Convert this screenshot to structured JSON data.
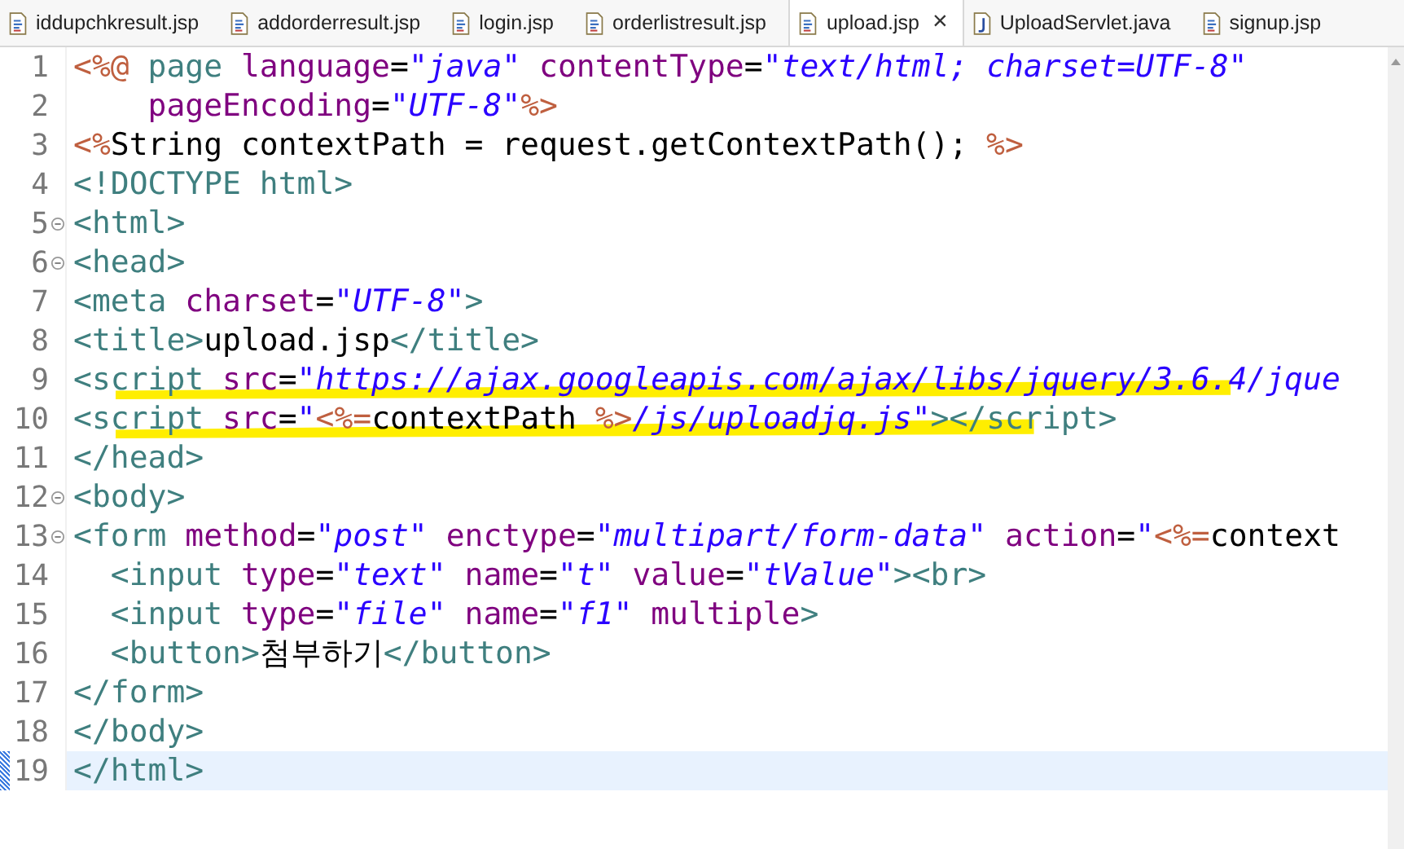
{
  "tabs": [
    {
      "label": "iddupchkresult.jsp",
      "kind": "jsp",
      "selected": false
    },
    {
      "label": "addorderresult.jsp",
      "kind": "jsp",
      "selected": false
    },
    {
      "label": "login.jsp",
      "kind": "jsp",
      "selected": false
    },
    {
      "label": "orderlistresult.jsp",
      "kind": "jsp",
      "selected": false
    },
    {
      "label": "upload.jsp",
      "kind": "jsp",
      "selected": true,
      "close": "×"
    },
    {
      "label": "UploadServlet.java",
      "kind": "java",
      "selected": false
    },
    {
      "label": "signup.jsp",
      "kind": "jsp",
      "selected": false
    }
  ],
  "editor": {
    "lines": [
      {
        "number": "1",
        "foldable": false,
        "current": false,
        "marked": false,
        "tokens": [
          {
            "kind": "jsp",
            "text": "<%@"
          },
          {
            "kind": "tag",
            "text": " page"
          },
          {
            "kind": "attr",
            "text": " language"
          },
          {
            "kind": "text",
            "text": "="
          },
          {
            "kind": "value",
            "text": "\"java\""
          },
          {
            "kind": "attr",
            "text": " contentType"
          },
          {
            "kind": "text",
            "text": "="
          },
          {
            "kind": "value",
            "text": "\"text/html; charset=UTF-8\""
          }
        ]
      },
      {
        "number": "2",
        "foldable": false,
        "current": false,
        "marked": false,
        "tokens": [
          {
            "kind": "attr",
            "text": "    pageEncoding"
          },
          {
            "kind": "text",
            "text": "="
          },
          {
            "kind": "value",
            "text": "\"UTF-8\""
          },
          {
            "kind": "jsp",
            "text": "%>"
          }
        ]
      },
      {
        "number": "3",
        "foldable": false,
        "current": false,
        "marked": false,
        "tokens": [
          {
            "kind": "jsp",
            "text": "<%"
          },
          {
            "kind": "text",
            "text": "String contextPath = request.getContextPath();"
          },
          {
            "kind": "jsp",
            "text": " %>"
          }
        ]
      },
      {
        "number": "4",
        "foldable": false,
        "current": false,
        "marked": false,
        "tokens": [
          {
            "kind": "tag",
            "text": "<!DOCTYPE html>"
          }
        ]
      },
      {
        "number": "5",
        "foldable": true,
        "current": false,
        "marked": false,
        "tokens": [
          {
            "kind": "tag",
            "text": "<html>"
          }
        ]
      },
      {
        "number": "6",
        "foldable": true,
        "current": false,
        "marked": false,
        "tokens": [
          {
            "kind": "tag",
            "text": "<head>"
          }
        ]
      },
      {
        "number": "7",
        "foldable": false,
        "current": false,
        "marked": false,
        "tokens": [
          {
            "kind": "tag",
            "text": "<meta"
          },
          {
            "kind": "attr",
            "text": " charset"
          },
          {
            "kind": "text",
            "text": "="
          },
          {
            "kind": "value",
            "text": "\"UTF-8\""
          },
          {
            "kind": "tag",
            "text": ">"
          }
        ]
      },
      {
        "number": "8",
        "foldable": false,
        "current": false,
        "marked": false,
        "tokens": [
          {
            "kind": "tag",
            "text": "<title>"
          },
          {
            "kind": "text",
            "text": "upload.jsp"
          },
          {
            "kind": "tag",
            "text": "</title>"
          }
        ]
      },
      {
        "number": "9",
        "foldable": false,
        "current": false,
        "marked": true,
        "tokens": [
          {
            "kind": "tag",
            "text": "<script"
          },
          {
            "kind": "attr",
            "text": " src"
          },
          {
            "kind": "text",
            "text": "="
          },
          {
            "kind": "value",
            "text": "\"https://ajax.googleapis.com/ajax/libs/jquery/3.6.4/jque"
          }
        ]
      },
      {
        "number": "10",
        "foldable": false,
        "current": false,
        "marked": true,
        "tokens": [
          {
            "kind": "tag",
            "text": "<script"
          },
          {
            "kind": "attr",
            "text": " src"
          },
          {
            "kind": "text",
            "text": "="
          },
          {
            "kind": "value",
            "text": "\""
          },
          {
            "kind": "jsp",
            "text": "<%="
          },
          {
            "kind": "text",
            "text": "contextPath"
          },
          {
            "kind": "jsp",
            "text": " %>"
          },
          {
            "kind": "value",
            "text": "/js/uploadjq.js\""
          },
          {
            "kind": "tag",
            "text": "></script>"
          }
        ]
      },
      {
        "number": "11",
        "foldable": false,
        "current": false,
        "marked": false,
        "tokens": [
          {
            "kind": "tag",
            "text": "</head>"
          }
        ]
      },
      {
        "number": "12",
        "foldable": true,
        "current": false,
        "marked": false,
        "tokens": [
          {
            "kind": "tag",
            "text": "<body>"
          }
        ]
      },
      {
        "number": "13",
        "foldable": true,
        "current": false,
        "marked": false,
        "tokens": [
          {
            "kind": "tag",
            "text": "<form"
          },
          {
            "kind": "attr",
            "text": " method"
          },
          {
            "kind": "text",
            "text": "="
          },
          {
            "kind": "value",
            "text": "\"post\""
          },
          {
            "kind": "attr",
            "text": " enctype"
          },
          {
            "kind": "text",
            "text": "="
          },
          {
            "kind": "value",
            "text": "\"multipart/form-data\""
          },
          {
            "kind": "attr",
            "text": " action"
          },
          {
            "kind": "text",
            "text": "="
          },
          {
            "kind": "value",
            "text": "\""
          },
          {
            "kind": "jsp",
            "text": "<%="
          },
          {
            "kind": "text",
            "text": "context"
          }
        ]
      },
      {
        "number": "14",
        "foldable": false,
        "current": false,
        "marked": false,
        "tokens": [
          {
            "kind": "tag",
            "text": "  <input"
          },
          {
            "kind": "attr",
            "text": " type"
          },
          {
            "kind": "text",
            "text": "="
          },
          {
            "kind": "value",
            "text": "\"text\""
          },
          {
            "kind": "attr",
            "text": " name"
          },
          {
            "kind": "text",
            "text": "="
          },
          {
            "kind": "value",
            "text": "\"t\""
          },
          {
            "kind": "attr",
            "text": " value"
          },
          {
            "kind": "text",
            "text": "="
          },
          {
            "kind": "value",
            "text": "\"tValue\""
          },
          {
            "kind": "tag",
            "text": "><br>"
          }
        ]
      },
      {
        "number": "15",
        "foldable": false,
        "current": false,
        "marked": false,
        "tokens": [
          {
            "kind": "tag",
            "text": "  <input"
          },
          {
            "kind": "attr",
            "text": " type"
          },
          {
            "kind": "text",
            "text": "="
          },
          {
            "kind": "value",
            "text": "\"file\""
          },
          {
            "kind": "attr",
            "text": " name"
          },
          {
            "kind": "text",
            "text": "="
          },
          {
            "kind": "value",
            "text": "\"f1\""
          },
          {
            "kind": "attr",
            "text": " multiple"
          },
          {
            "kind": "tag",
            "text": ">"
          }
        ]
      },
      {
        "number": "16",
        "foldable": false,
        "current": false,
        "marked": false,
        "tokens": [
          {
            "kind": "tag",
            "text": "  <button>"
          },
          {
            "kind": "text",
            "text": "첨부하기"
          },
          {
            "kind": "tag",
            "text": "</button>"
          }
        ]
      },
      {
        "number": "17",
        "foldable": false,
        "current": false,
        "marked": false,
        "tokens": [
          {
            "kind": "tag",
            "text": "</form>"
          }
        ]
      },
      {
        "number": "18",
        "foldable": false,
        "current": false,
        "marked": false,
        "tokens": [
          {
            "kind": "tag",
            "text": "</body>"
          }
        ]
      },
      {
        "number": "19",
        "foldable": false,
        "current": true,
        "marked": false,
        "tokens": [
          {
            "kind": "tag",
            "text": "</html>"
          }
        ]
      }
    ]
  }
}
